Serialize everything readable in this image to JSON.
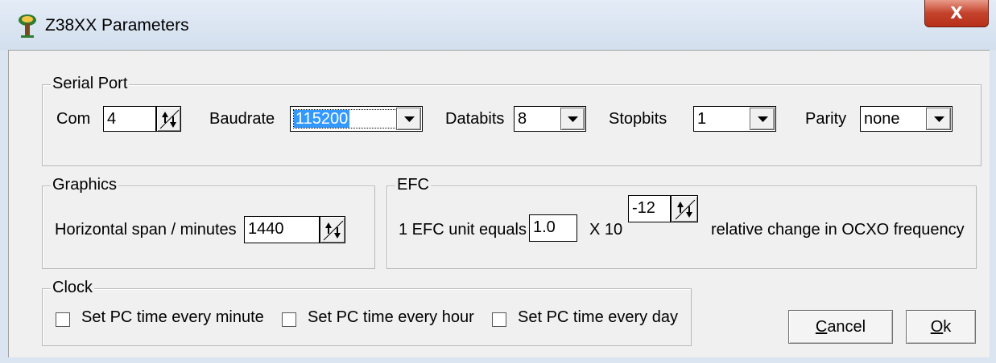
{
  "window": {
    "title": "Z38XX Parameters",
    "close_glyph": "X",
    "icon": "app-icon"
  },
  "serial_port": {
    "legend": "Serial Port",
    "com_label": "Com",
    "com_value": "4",
    "baudrate_label": "Baudrate",
    "baudrate_value": "115200",
    "databits_label": "Databits",
    "databits_value": "8",
    "stopbits_label": "Stopbits",
    "stopbits_value": "1",
    "parity_label": "Parity",
    "parity_value": "none"
  },
  "graphics": {
    "legend": "Graphics",
    "span_label": "Horizontal span / minutes",
    "span_value": "1440"
  },
  "efc": {
    "legend": "EFC",
    "unit_label": "1 EFC unit equals",
    "unit_value": "1.0",
    "times_label": "X 10",
    "exponent_value": "-12",
    "suffix_label": "relative change in OCXO frequency"
  },
  "clock": {
    "legend": "Clock",
    "options": [
      {
        "label": "Set PC time every minute",
        "checked": false
      },
      {
        "label": "Set PC time every hour",
        "checked": false
      },
      {
        "label": "Set PC time every day",
        "checked": false
      }
    ]
  },
  "buttons": {
    "cancel_mnemonic": "C",
    "cancel_rest": "ancel",
    "ok_mnemonic": "O",
    "ok_rest": "k"
  }
}
